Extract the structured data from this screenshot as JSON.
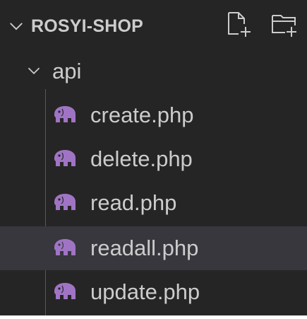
{
  "explorer": {
    "project_name": "ROSYI-SHOP",
    "folder": {
      "name": "api",
      "expanded": true,
      "files": [
        {
          "name": "create.php",
          "icon": "php-elephant-icon",
          "selected": false
        },
        {
          "name": "delete.php",
          "icon": "php-elephant-icon",
          "selected": false
        },
        {
          "name": "read.php",
          "icon": "php-elephant-icon",
          "selected": false
        },
        {
          "name": "readall.php",
          "icon": "php-elephant-icon",
          "selected": true
        },
        {
          "name": "update.php",
          "icon": "php-elephant-icon",
          "selected": false
        }
      ]
    },
    "actions": [
      {
        "name": "new-file",
        "icon": "new-file-icon"
      },
      {
        "name": "new-folder",
        "icon": "new-folder-icon"
      }
    ],
    "colors": {
      "background": "#252526",
      "selected_row": "#37373d",
      "text": "#cccccc",
      "php_icon": "#a074c4"
    }
  }
}
